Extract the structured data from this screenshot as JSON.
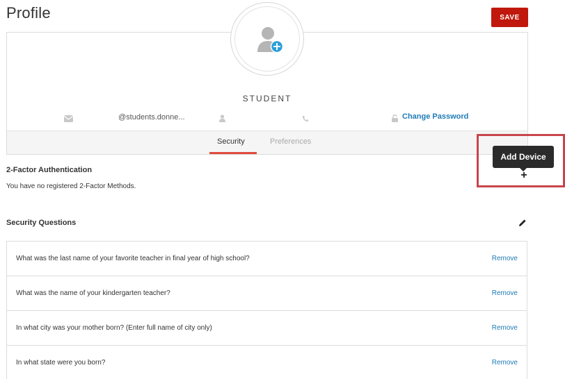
{
  "page": {
    "title": "Profile"
  },
  "toolbar": {
    "save_label": "SAVE"
  },
  "profile": {
    "avatar_icon": "user-add-icon",
    "role": "STUDENT",
    "email": "@students.donne...",
    "phone": "",
    "username": "",
    "change_password_label": "Change Password"
  },
  "tabs": [
    {
      "label": "Security",
      "active": true
    },
    {
      "label": "Preferences",
      "active": false
    }
  ],
  "two_factor": {
    "title": "2-Factor Authentication",
    "message": "You have no registered 2-Factor Methods.",
    "add_tooltip": "Add Device",
    "add_symbol": "+"
  },
  "security_questions": {
    "title": "Security Questions",
    "items": [
      {
        "question": "What was the last name of your favorite teacher in final year of high school?",
        "action": "Remove"
      },
      {
        "question": "What was the name of your kindergarten teacher?",
        "action": "Remove"
      },
      {
        "question": "In what city was your mother born? (Enter full name of city only)",
        "action": "Remove"
      },
      {
        "question": "In what state were you born?",
        "action": "Remove"
      }
    ]
  },
  "colors": {
    "accent_red": "#c0180c",
    "link_blue": "#1f7bb5",
    "tab_underline": "#e04a3c",
    "highlight": "#c8454b",
    "avatar_plus": "#2a9fd8"
  }
}
